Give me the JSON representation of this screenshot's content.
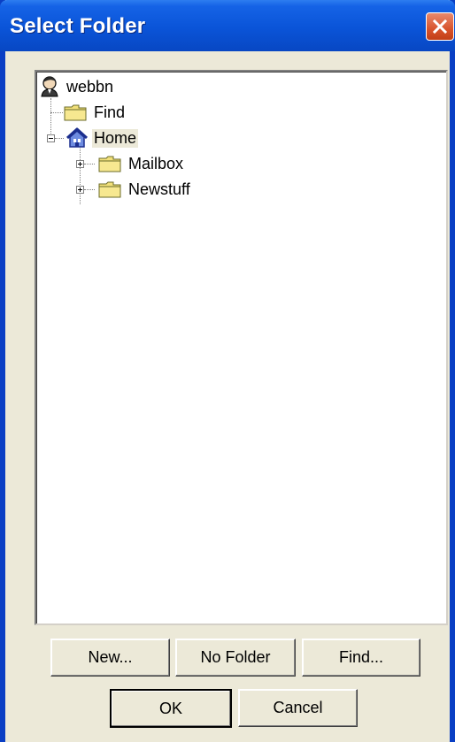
{
  "window": {
    "title": "Select Folder",
    "close_icon": "close-icon"
  },
  "tree": {
    "root": {
      "label": "webbn",
      "icon": "user-icon"
    },
    "items": [
      {
        "label": "Find",
        "icon": "folder-icon"
      },
      {
        "label": "Home",
        "icon": "home-icon",
        "expanded": true,
        "selected": true
      },
      {
        "label": "Mailbox",
        "icon": "folder-icon",
        "expanded": false
      },
      {
        "label": "Newstuff",
        "icon": "folder-icon",
        "expanded": false
      }
    ]
  },
  "buttons": {
    "new_label": "New...",
    "no_folder_label": "No Folder",
    "find_label": "Find...",
    "ok_label": "OK",
    "cancel_label": "Cancel"
  },
  "colors": {
    "titlebar": "#0a54d8",
    "dialog_bg": "#ece9d8",
    "close_button": "#d8532c",
    "folder": "#f2e07a"
  }
}
